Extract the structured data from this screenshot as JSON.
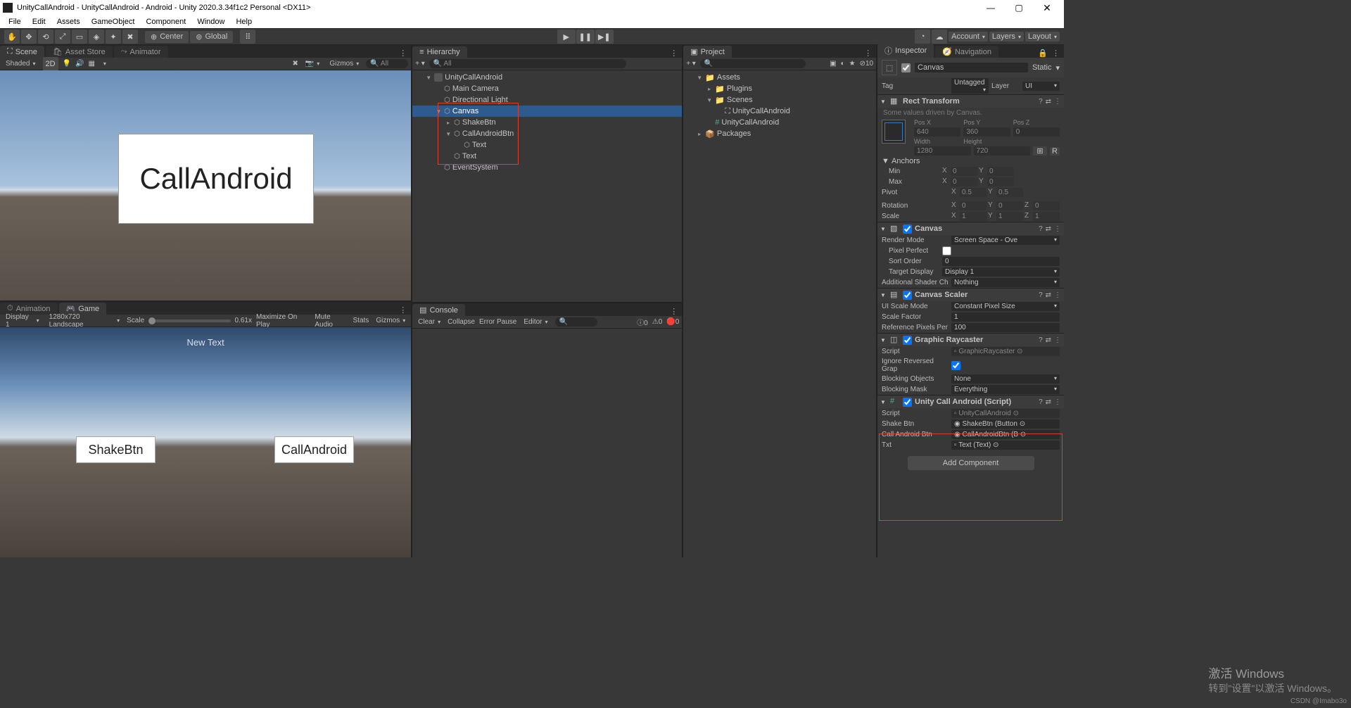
{
  "title": "UnityCallAndroid - UnityCallAndroid - Android - Unity 2020.3.34f1c2 Personal <DX11>",
  "menu": [
    "File",
    "Edit",
    "Assets",
    "GameObject",
    "Component",
    "Window",
    "Help"
  ],
  "toolbar": {
    "center": "Center",
    "global": "Global",
    "account": "Account",
    "layers": "Layers",
    "layout": "Layout"
  },
  "tabs": {
    "scene": "Scene",
    "assetstore": "Asset Store",
    "animator": "Animator",
    "animation": "Animation",
    "game": "Game",
    "hierarchy": "Hierarchy",
    "project": "Project",
    "console": "Console",
    "inspector": "Inspector",
    "navigation": "Navigation"
  },
  "sceneToolbar": {
    "shaded": "Shaded",
    "mode2d": "2D",
    "gizmos": "Gizmos",
    "searchPlaceholder": "All"
  },
  "sceneBigButton": "CallAndroid",
  "gameToolbar": {
    "display": "Display 1",
    "aspect": "1280x720 Landscape",
    "scale": "Scale",
    "scaleVal": "0.61x",
    "maximize": "Maximize On Play",
    "mute": "Mute Audio",
    "stats": "Stats",
    "gizmos": "Gizmos"
  },
  "gameView": {
    "newText": "New Text",
    "shakeBtn": "ShakeBtn",
    "callBtn": "CallAndroid"
  },
  "hierarchy": {
    "searchPlaceholder": "All",
    "root": "UnityCallAndroid",
    "items": [
      "Main Camera",
      "Directional Light",
      "Canvas",
      "ShakeBtn",
      "CallAndroidBtn",
      "Text",
      "Text",
      "EventSystem"
    ]
  },
  "console": {
    "clear": "Clear",
    "collapse": "Collapse",
    "errorPause": "Error Pause",
    "editor": "Editor",
    "counts": {
      "info": "0",
      "warn": "0",
      "err": "0"
    }
  },
  "project": {
    "assets": "Assets",
    "plugins": "Plugins",
    "scenes": "Scenes",
    "sceneFile": "UnityCallAndroid",
    "script": "UnityCallAndroid",
    "packages": "Packages",
    "count": "10"
  },
  "inspector": {
    "name": "Canvas",
    "static": "Static",
    "tagLabel": "Tag",
    "tag": "Untagged",
    "layerLabel": "Layer",
    "layer": "UI",
    "rect": {
      "title": "Rect Transform",
      "hint": "Some values driven by Canvas.",
      "posx": "Pos X",
      "posy": "Pos Y",
      "posz": "Pos Z",
      "posxV": "640",
      "posyV": "360",
      "poszV": "0",
      "width": "Width",
      "height": "Height",
      "widthV": "1280",
      "heightV": "720",
      "anchors": "Anchors",
      "min": "Min",
      "max": "Max",
      "pivot": "Pivot",
      "minX": "0",
      "minY": "0",
      "maxX": "0",
      "maxY": "0",
      "pivX": "0.5",
      "pivY": "0.5",
      "rotation": "Rotation",
      "rotX": "0",
      "rotY": "0",
      "rotZ": "0",
      "scale": "Scale",
      "scX": "1",
      "scY": "1",
      "scZ": "1"
    },
    "canvas": {
      "title": "Canvas",
      "renderMode": "Render Mode",
      "renderModeV": "Screen Space - Ove",
      "pixelPerfect": "Pixel Perfect",
      "sortOrder": "Sort Order",
      "sortOrderV": "0",
      "targetDisplay": "Target Display",
      "targetDisplayV": "Display 1",
      "addShader": "Additional Shader Ch",
      "addShaderV": "Nothing"
    },
    "scaler": {
      "title": "Canvas Scaler",
      "uiScale": "UI Scale Mode",
      "uiScaleV": "Constant Pixel Size",
      "scaleFactor": "Scale Factor",
      "scaleFactorV": "1",
      "refPx": "Reference Pixels Per",
      "refPxV": "100"
    },
    "raycaster": {
      "title": "Graphic Raycaster",
      "script": "Script",
      "scriptV": "GraphicRaycaster",
      "ignore": "Ignore Reversed Grap",
      "blockObj": "Blocking Objects",
      "blockObjV": "None",
      "blockMask": "Blocking Mask",
      "blockMaskV": "Everything"
    },
    "callScript": {
      "title": "Unity Call Android (Script)",
      "script": "Script",
      "scriptV": "UnityCallAndroid",
      "shake": "Shake Btn",
      "shakeV": "ShakeBtn (Button",
      "call": "Call Android Btn",
      "callV": "CallAndroidBtn (B",
      "txt": "Txt",
      "txtV": "Text (Text)"
    },
    "addComponent": "Add Component"
  },
  "watermark": {
    "line1": "激活 Windows",
    "line2": "转到\"设置\"以激活 Windows。"
  },
  "csdn": "CSDN @Imabo3o"
}
